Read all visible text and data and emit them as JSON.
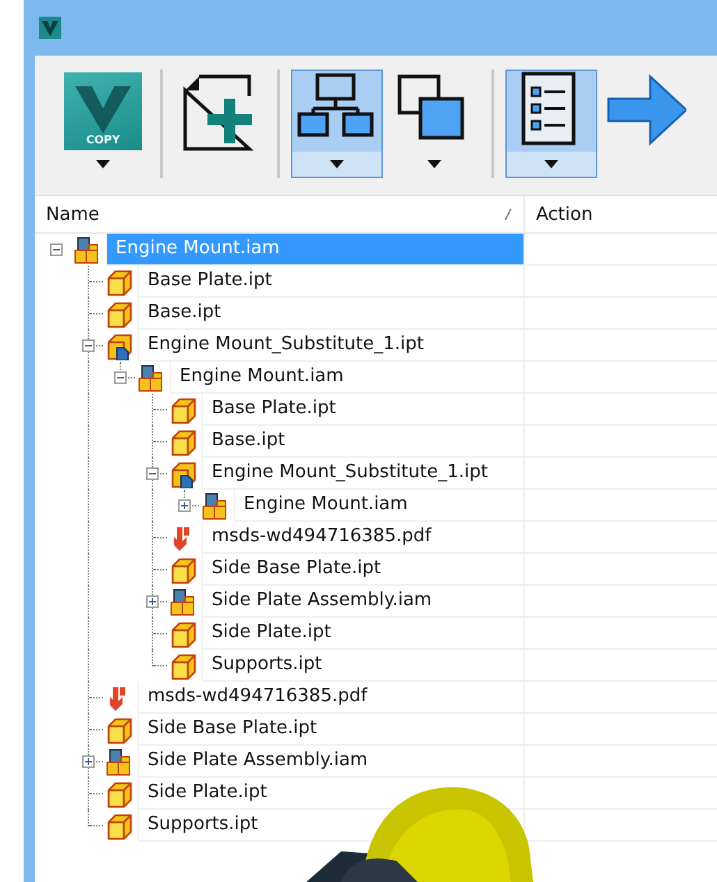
{
  "toolbar": [
    {
      "kind": "copy",
      "label": "COPY",
      "dropdown": true,
      "pressed": false
    },
    {
      "kind": "separator"
    },
    {
      "kind": "new",
      "dropdown": false,
      "pressed": false
    },
    {
      "kind": "separator"
    },
    {
      "kind": "tree",
      "dropdown": true,
      "pressed": true
    },
    {
      "kind": "overlap",
      "dropdown": true,
      "pressed": false
    },
    {
      "kind": "separator"
    },
    {
      "kind": "list",
      "dropdown": true,
      "pressed": true
    },
    {
      "kind": "arrow",
      "dropdown": false,
      "pressed": false
    }
  ],
  "table": {
    "columns": [
      "Name",
      "Action"
    ],
    "tree": [
      {
        "name": "Engine Mount.iam",
        "kind": "assembly",
        "selected": true,
        "expanded": true,
        "children": [
          {
            "name": "Base Plate.ipt",
            "kind": "part",
            "selected": false
          },
          {
            "name": "Base.ipt",
            "kind": "part",
            "selected": false
          },
          {
            "name": "Engine Mount_Substitute_1.ipt",
            "kind": "substitute",
            "selected": false,
            "expanded": true,
            "children": [
              {
                "name": "Engine Mount.iam",
                "kind": "assembly",
                "selected": false,
                "expanded": true,
                "children": [
                  {
                    "name": "Base Plate.ipt",
                    "kind": "part",
                    "selected": false
                  },
                  {
                    "name": "Base.ipt",
                    "kind": "part",
                    "selected": false
                  },
                  {
                    "name": "Engine Mount_Substitute_1.ipt",
                    "kind": "substitute",
                    "selected": false,
                    "expanded": true,
                    "children": [
                      {
                        "name": "Engine Mount.iam",
                        "kind": "assembly",
                        "selected": false,
                        "expanded": false
                      }
                    ]
                  },
                  {
                    "name": "msds-wd494716385.pdf",
                    "kind": "pdf",
                    "selected": false
                  },
                  {
                    "name": "Side Base Plate.ipt",
                    "kind": "part",
                    "selected": false
                  },
                  {
                    "name": "Side Plate Assembly.iam",
                    "kind": "assembly",
                    "selected": false,
                    "expanded": false
                  },
                  {
                    "name": "Side Plate.ipt",
                    "kind": "part",
                    "selected": false
                  },
                  {
                    "name": "Supports.ipt",
                    "kind": "part",
                    "selected": false
                  }
                ]
              }
            ]
          },
          {
            "name": "msds-wd494716385.pdf",
            "kind": "pdf",
            "selected": false
          },
          {
            "name": "Side Base Plate.ipt",
            "kind": "part",
            "selected": false
          },
          {
            "name": "Side Plate Assembly.iam",
            "kind": "assembly",
            "selected": false,
            "expanded": false
          },
          {
            "name": "Side Plate.ipt",
            "kind": "part",
            "selected": false
          },
          {
            "name": "Supports.ipt",
            "kind": "part",
            "selected": false
          }
        ]
      }
    ]
  }
}
